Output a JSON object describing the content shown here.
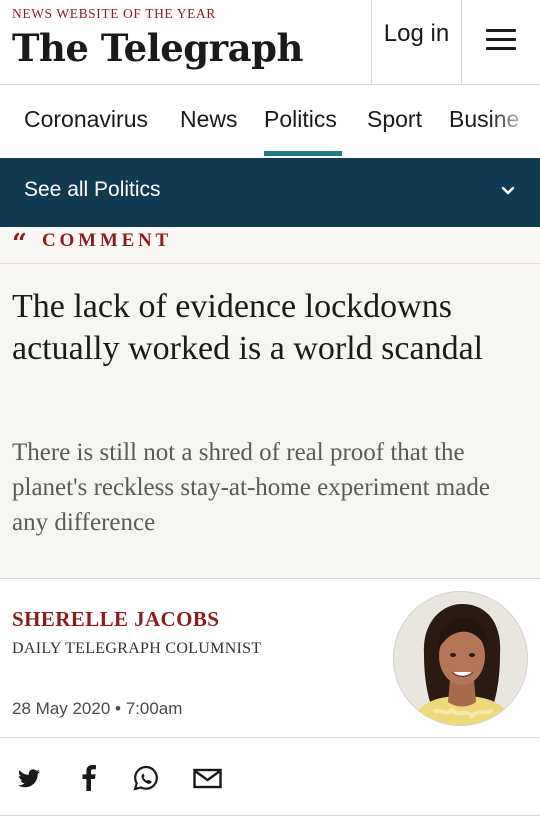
{
  "header": {
    "tagline": "NEWS WEBSITE OF THE YEAR",
    "logo_text": "The Telegraph",
    "login_label": "Log in",
    "menu_icon": "hamburger-icon"
  },
  "nav": {
    "items": [
      {
        "label": "Coronavirus"
      },
      {
        "label": "News"
      },
      {
        "label": "Politics",
        "active": true
      },
      {
        "label": "Sport"
      },
      {
        "label": "Busine"
      }
    ]
  },
  "section_bar": {
    "label": "See all Politics",
    "icon": "chevron-down-icon"
  },
  "article": {
    "section_label": "COMMENT",
    "quote_icon": "quote-icon",
    "headline": "The lack of evidence lockdowns actually worked is a world scandal",
    "standfirst": "There is still not a shred of real proof that the planet's reckless stay-at-home experiment made any difference",
    "author": {
      "name": "SHERELLE JACOBS",
      "role": "DAILY TELEGRAPH COLUMNIST"
    },
    "date": "28 May 2020 • 7:00am"
  },
  "share": {
    "icons": [
      "twitter-icon",
      "facebook-icon",
      "whatsapp-icon",
      "email-icon"
    ]
  },
  "colors": {
    "brand_red": "#8b1d1d",
    "nav_active": "#1f7c8a",
    "section_bar_bg": "#0f3a52",
    "article_bg": "#f7f5f0"
  }
}
